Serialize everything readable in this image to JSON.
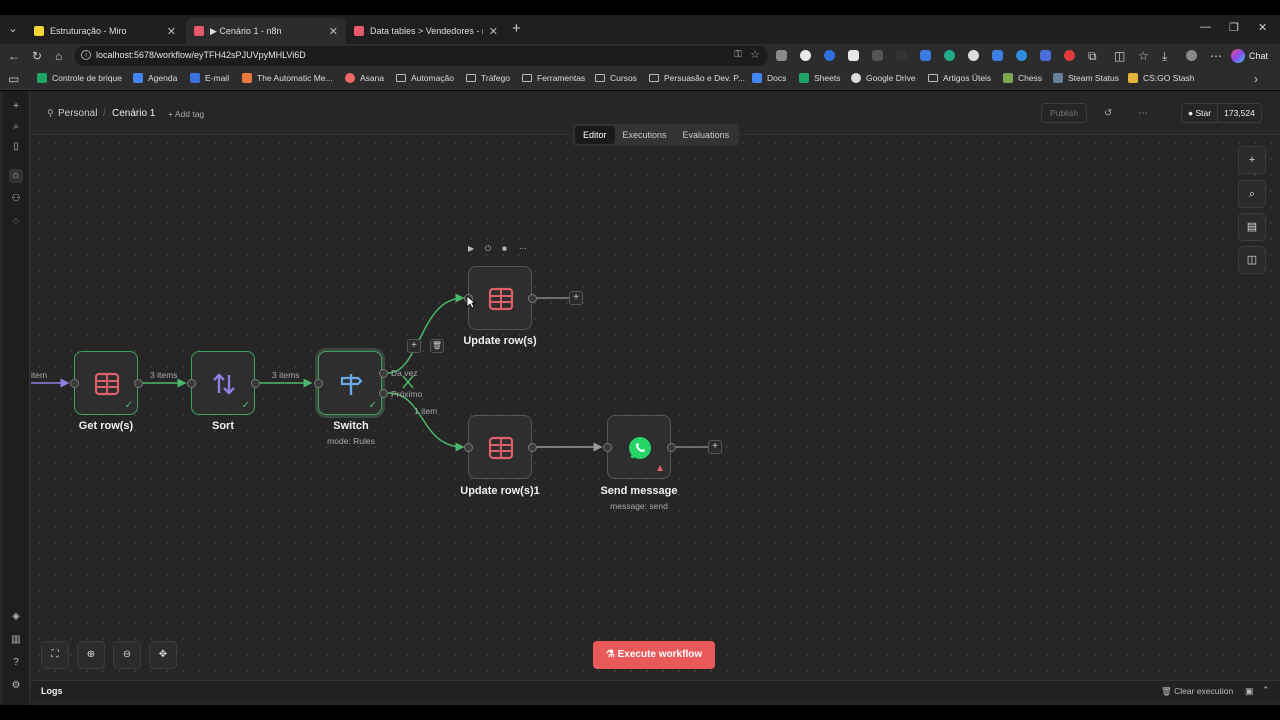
{
  "browser": {
    "tabs": [
      {
        "title": "Estruturação - Miro",
        "fav_color": "#f5d533"
      },
      {
        "title": "▶ Cenário 1 - n8n",
        "fav_color": "#e85a6b"
      },
      {
        "title": "Data tables > Vendedores - n8n",
        "fav_color": "#e85a6b"
      }
    ],
    "url": "localhost:5678/workflow/eyTFH42sPJUVpyMHLVi6D",
    "chat_label": "Chat",
    "bookmarks": [
      {
        "label": "Controle de brique",
        "kind": "sheet"
      },
      {
        "label": "Agenda",
        "kind": "calendar"
      },
      {
        "label": "E-mail",
        "kind": "mail"
      },
      {
        "label": "The Automatic Me...",
        "kind": "site"
      },
      {
        "label": "Asana",
        "kind": "asana"
      },
      {
        "label": "Automação",
        "kind": "folder"
      },
      {
        "label": "Tráfego",
        "kind": "folder"
      },
      {
        "label": "Ferramentas",
        "kind": "folder"
      },
      {
        "label": "Cursos",
        "kind": "folder"
      },
      {
        "label": "Persuasão e Dev. P...",
        "kind": "folder"
      },
      {
        "label": "Docs",
        "kind": "docs"
      },
      {
        "label": "Sheets",
        "kind": "sheet"
      },
      {
        "label": "Google Drive",
        "kind": "drive"
      },
      {
        "label": "Artigos Úteis",
        "kind": "folder"
      },
      {
        "label": "Chess",
        "kind": "chess"
      },
      {
        "label": "Steam Status",
        "kind": "steam"
      },
      {
        "label": "CS:GO Stash",
        "kind": "csgo"
      }
    ]
  },
  "header": {
    "project": "Personal",
    "separator": "/",
    "workflow_name": "Cenário 1",
    "add_tag": "+ Add tag",
    "publish": "Publish",
    "star_label": "Star",
    "star_count": "173,524",
    "tabs": [
      "Editor",
      "Executions",
      "Evaluations"
    ]
  },
  "nodes": {
    "get_rows": {
      "label": "Get row(s)"
    },
    "sort": {
      "label": "Sort"
    },
    "switch": {
      "label": "Switch",
      "sub": "mode: Rules"
    },
    "update_rows": {
      "label": "Update row(s)"
    },
    "update_rows1": {
      "label": "Update row(s)1"
    },
    "send_message": {
      "label": "Send message",
      "sub": "message: send"
    }
  },
  "edges": {
    "incoming": "item",
    "get_to_sort": "3 items",
    "sort_to_switch": "3 items",
    "switch_out1": "Da vez",
    "switch_out2": "Próximo",
    "switch_to_update1": "1 item"
  },
  "footer": {
    "execute": "Execute workflow",
    "logs": "Logs",
    "clear_execution": "Clear execution"
  },
  "colors": {
    "success": "#3fa25b",
    "execute": "#e9595a",
    "table_icon": "#e0606a",
    "whatsapp": "#25d366",
    "sort_icon": "#8f7fe0",
    "switch_icon": "#6ca8e8"
  }
}
